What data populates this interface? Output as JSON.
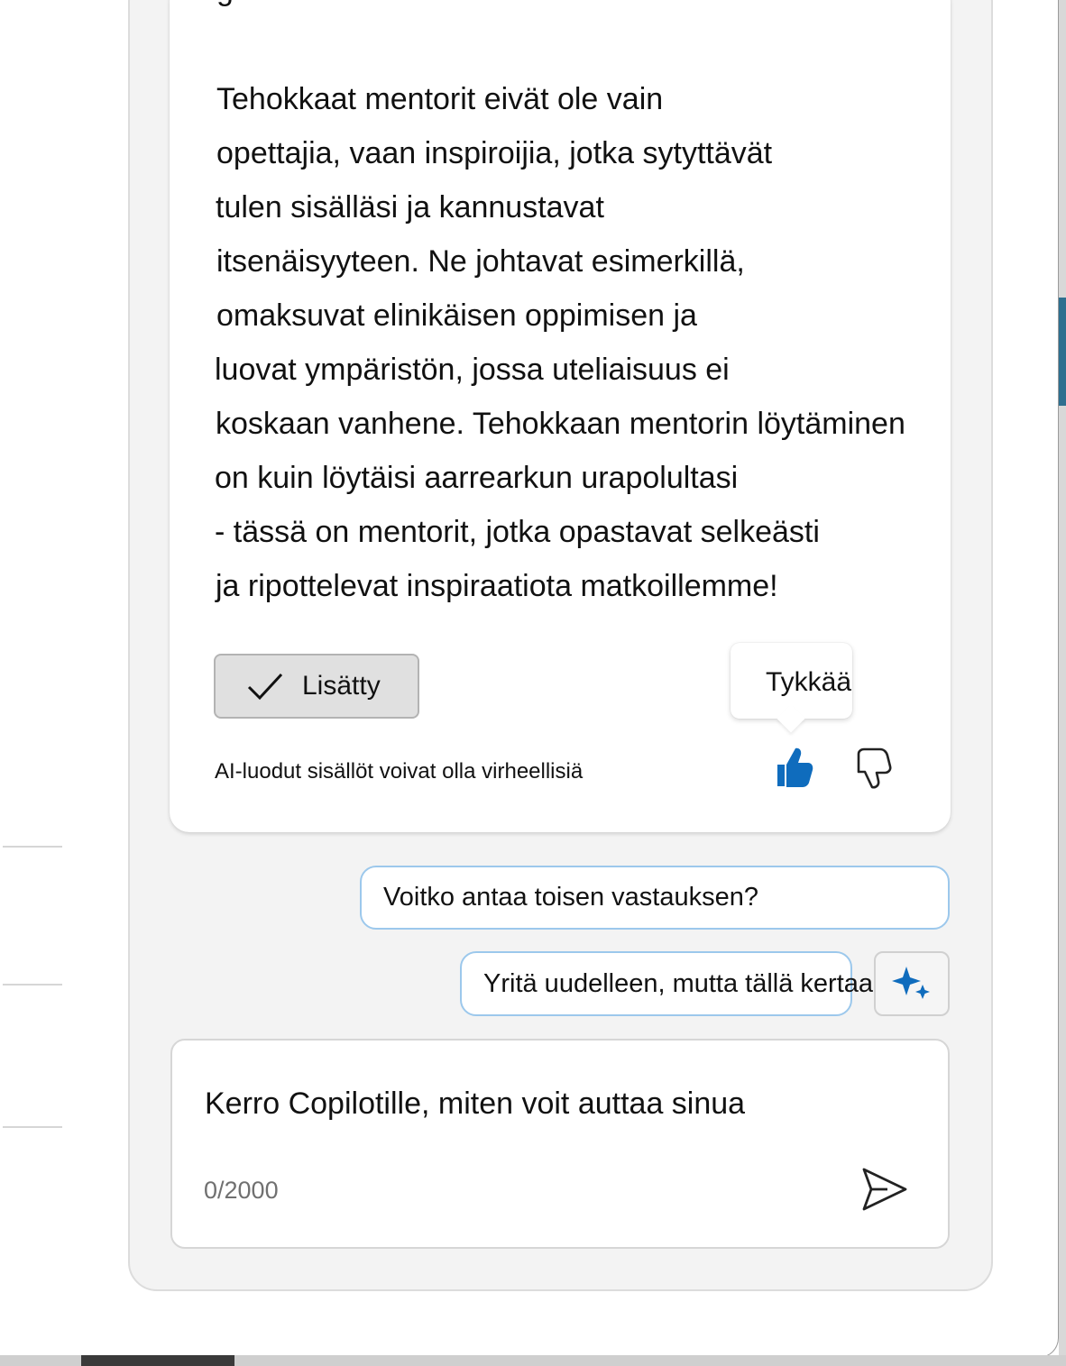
{
  "card": {
    "cut_top_text": "g",
    "lines": [
      "Tehokkaat mentorit eivät ole vain",
      "opettajia, vaan inspiroijia, jotka sytyttävät",
      "tulen sisälläsi ja kannustavat",
      "itsenäisyyteen. Ne johtavat esimerkillä,",
      "omaksuvat elinikäisen oppimisen ja",
      "luovat ympäristön, jossa uteliaisuus ei",
      "koskaan vanhene. Tehokkaan mentorin löytäminen",
      "on kuin löytäisi aarrearkun urapolultasi",
      "- tässä on mentorit, jotka opastavat selkeästi",
      "ja ripottelevat inspiraatiota matkoillemme!"
    ],
    "added_button_label": "Lisätty",
    "disclaimer": "AI-luodut sisällöt voivat olla virheellisiä",
    "like_tooltip": "Tykkää",
    "like_icon": "thumbs-up-icon",
    "dislike_icon": "thumbs-down-icon",
    "accent_color": "#0f6cbd"
  },
  "suggestions": [
    "Voitko antaa toisen vastauksen?",
    "Yritä uudelleen, mutta tällä kertaa..."
  ],
  "suggestion_overflow": "..",
  "composer": {
    "placeholder": "Kerro Copilotille, miten voit auttaa sinua",
    "char_count": "0/2000",
    "send_icon": "send-icon"
  }
}
